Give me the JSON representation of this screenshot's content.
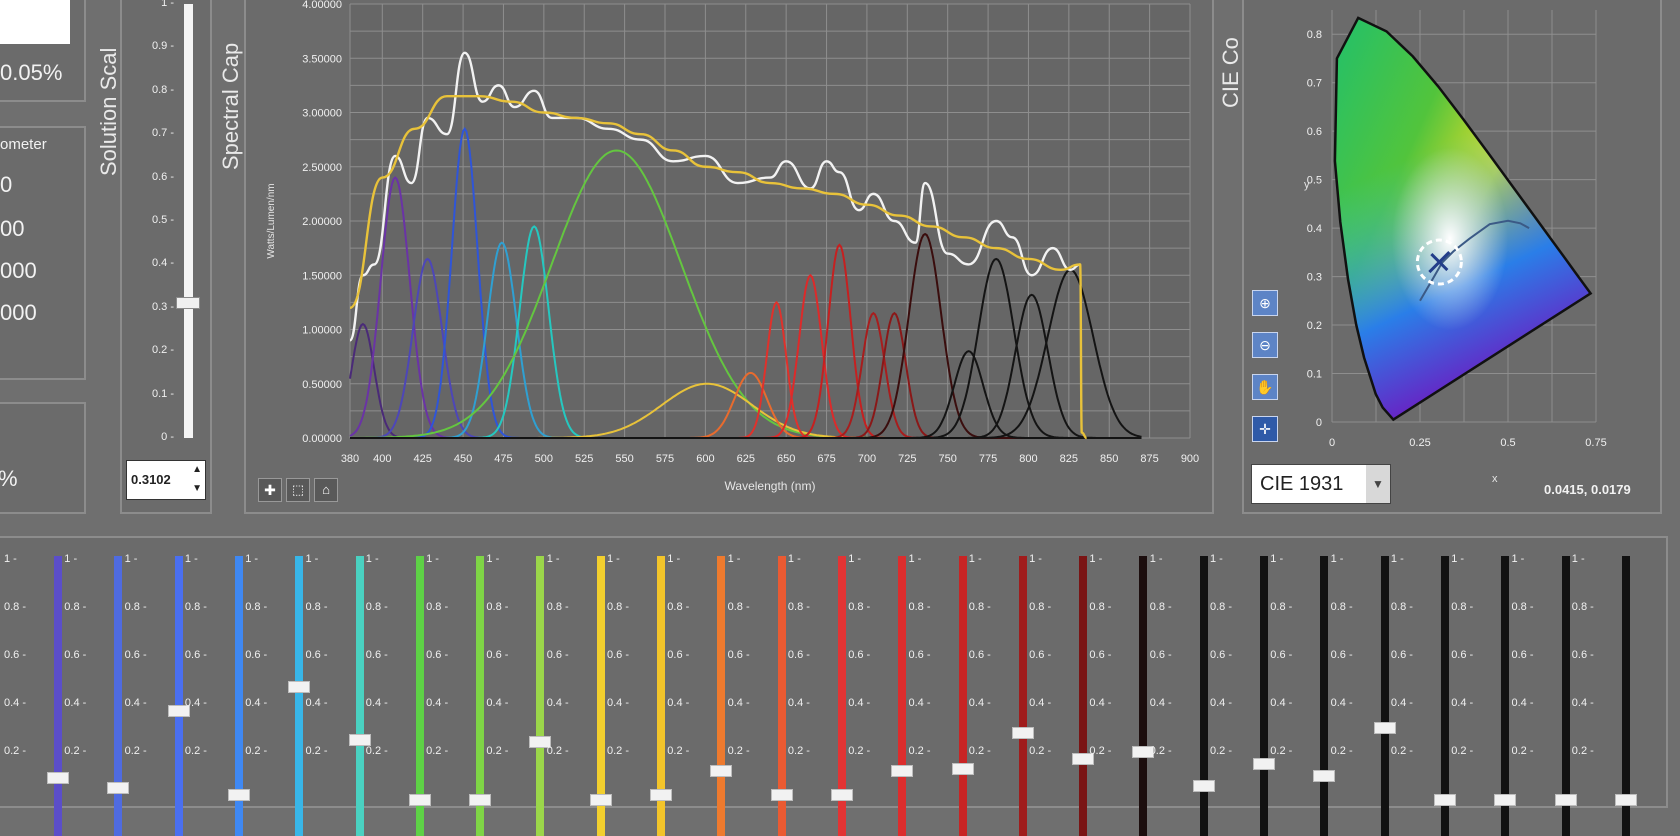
{
  "left_partial": {
    "box1_value": "0.05%",
    "box2_title": "ometer",
    "box2_values": [
      "0",
      "00",
      "000",
      "000"
    ],
    "box3_value": "%"
  },
  "solution_scale": {
    "title": "Solution Scal",
    "ticks": [
      "1",
      "0.9",
      "0.8",
      "0.7",
      "0.6",
      "0.5",
      "0.4",
      "0.3",
      "0.2",
      "0.1",
      "0"
    ],
    "value": 0.31,
    "input_value": "0.3102"
  },
  "spectral": {
    "title": "Spectral Cap",
    "ylabel": "Watts/Lumen/nm",
    "xlabel": "Wavelength (nm)",
    "y_ticks": [
      "0.00000",
      "0.50000",
      "1.00000",
      "1.50000",
      "2.00000",
      "2.50000",
      "3.00000",
      "3.50000",
      "4.00000"
    ],
    "x_ticks": [
      "380",
      "400",
      "425",
      "450",
      "475",
      "500",
      "525",
      "550",
      "575",
      "600",
      "625",
      "650",
      "675",
      "700",
      "725",
      "750",
      "775",
      "800",
      "825",
      "850",
      "875",
      "900"
    ]
  },
  "chart_data": {
    "type": "line",
    "xlabel": "Wavelength (nm)",
    "ylabel": "Watts/Lumen/nm",
    "xlim": [
      380,
      900
    ],
    "ylim": [
      0,
      4
    ],
    "grid": true,
    "series": [
      {
        "color": "#4a2a78",
        "peak_x": 388,
        "peak_y": 1.05,
        "width": 7
      },
      {
        "color": "#6a33a6",
        "peak_x": 408,
        "peak_y": 2.4,
        "width": 9
      },
      {
        "color": "#4d46b8",
        "peak_x": 428,
        "peak_y": 1.65,
        "width": 9
      },
      {
        "color": "#2f55d8",
        "peak_x": 451,
        "peak_y": 2.85,
        "width": 8
      },
      {
        "color": "#2fa0d2",
        "peak_x": 474,
        "peak_y": 1.8,
        "width": 9
      },
      {
        "color": "#25c8c0",
        "peak_x": 494,
        "peak_y": 1.95,
        "width": 9
      },
      {
        "color": "#64c640",
        "peak_x": 545,
        "peak_y": 2.65,
        "width": 40
      },
      {
        "color": "#e8c23a",
        "peak_x": 601,
        "peak_y": 0.5,
        "width": 28
      },
      {
        "color": "#e86b2e",
        "peak_x": 628,
        "peak_y": 0.6,
        "width": 10
      },
      {
        "color": "#e0312b",
        "peak_x": 644,
        "peak_y": 1.25,
        "width": 6
      },
      {
        "color": "#dd2a2a",
        "peak_x": 665,
        "peak_y": 1.5,
        "width": 7
      },
      {
        "color": "#c62020",
        "peak_x": 683,
        "peak_y": 1.78,
        "width": 7
      },
      {
        "color": "#a81d1d",
        "peak_x": 704,
        "peak_y": 1.15,
        "width": 7
      },
      {
        "color": "#8a1818",
        "peak_x": 717,
        "peak_y": 1.15,
        "width": 7
      },
      {
        "color": "#3a0d0d",
        "peak_x": 736,
        "peak_y": 1.88,
        "width": 10
      },
      {
        "color": "#141414",
        "peak_x": 763,
        "peak_y": 0.8,
        "width": 9
      },
      {
        "color": "#141414",
        "peak_x": 780,
        "peak_y": 1.65,
        "width": 11
      },
      {
        "color": "#141414",
        "peak_x": 802,
        "peak_y": 1.32,
        "width": 10
      },
      {
        "color": "#141414",
        "peak_x": 826,
        "peak_y": 1.55,
        "width": 14
      },
      {
        "color": "#f2f2f2",
        "name": "",
        "x": [
          380,
          388,
          395,
          408,
          418,
          428,
          440,
          451,
          462,
          472,
          482,
          494,
          505,
          520,
          540,
          560,
          580,
          600,
          620,
          640,
          650,
          665,
          675,
          683,
          695,
          704,
          717,
          730,
          736,
          750,
          763,
          780,
          790,
          802,
          815,
          826,
          832
        ],
        "y": [
          0.9,
          1.5,
          1.6,
          2.6,
          2.35,
          2.95,
          2.8,
          3.55,
          3.1,
          3.25,
          3.05,
          3.2,
          2.95,
          2.95,
          2.85,
          2.75,
          2.55,
          2.6,
          2.35,
          2.4,
          2.55,
          2.3,
          2.55,
          2.45,
          2.1,
          2.25,
          2.0,
          1.8,
          2.35,
          1.7,
          1.6,
          2.0,
          1.85,
          1.5,
          1.75,
          1.55,
          1.6
        ]
      },
      {
        "color": "#e8c23a",
        "name": "",
        "x": [
          380,
          400,
          420,
          440,
          460,
          480,
          500,
          520,
          540,
          560,
          580,
          600,
          620,
          640,
          660,
          680,
          700,
          720,
          740,
          760,
          780,
          800,
          820,
          832,
          833,
          836
        ],
        "y": [
          1.2,
          2.4,
          2.85,
          3.15,
          3.15,
          3.1,
          3.0,
          2.95,
          2.9,
          2.8,
          2.65,
          2.5,
          2.45,
          2.35,
          2.3,
          2.25,
          2.15,
          2.05,
          1.95,
          1.85,
          1.75,
          1.65,
          1.55,
          1.6,
          0.05,
          0
        ]
      }
    ]
  },
  "chart_tools": [
    "zoom-tool-icon",
    "pan-tool-icon",
    "home-tool-icon"
  ],
  "cie": {
    "title": "CIE Co",
    "y_ticks": [
      "0",
      "0.1",
      "0.2",
      "0.3",
      "0.4",
      "0.5",
      "0.6",
      "0.7",
      "0.8"
    ],
    "x_ticks": [
      "0",
      "0.25",
      "0.5",
      "0.75"
    ],
    "xlabel": "x",
    "ylabel": "y",
    "select_value": "CIE 1931",
    "coord_readout": "0.0415, 0.0179",
    "tools": [
      "zoom-in-icon",
      "zoom-out-icon",
      "pan-icon",
      "crosshair-icon"
    ]
  },
  "channels": {
    "tick_labels": [
      "1",
      "0.8",
      "0.6",
      "0.4",
      "0.2"
    ],
    "items": [
      {
        "color": "#5b4ec9",
        "level": 0.09
      },
      {
        "color": "#4f6be0",
        "level": 0.05
      },
      {
        "color": "#4a6ff0",
        "level": 0.37
      },
      {
        "color": "#3f88f2",
        "level": 0.02
      },
      {
        "color": "#38b6e8",
        "level": 0.47
      },
      {
        "color": "#4ad1c1",
        "level": 0.25
      },
      {
        "color": "#5ed146",
        "level": 0.0
      },
      {
        "color": "#7fd446",
        "level": 0.0
      },
      {
        "color": "#9bd64a",
        "level": 0.24
      },
      {
        "color": "#f2cf2e",
        "level": 0.0
      },
      {
        "color": "#f2c42a",
        "level": 0.02
      },
      {
        "color": "#ee7a2e",
        "level": 0.12
      },
      {
        "color": "#ea5a32",
        "level": 0.02
      },
      {
        "color": "#e23434",
        "level": 0.02
      },
      {
        "color": "#dc2d2d",
        "level": 0.12
      },
      {
        "color": "#c82424",
        "level": 0.13
      },
      {
        "color": "#a01c1c",
        "level": 0.28
      },
      {
        "color": "#7a1414",
        "level": 0.17
      },
      {
        "color": "#1c0e0e",
        "level": 0.2
      },
      {
        "color": "#121212",
        "level": 0.06
      },
      {
        "color": "#121212",
        "level": 0.15
      },
      {
        "color": "#121212",
        "level": 0.1
      },
      {
        "color": "#121212",
        "level": 0.3
      },
      {
        "color": "#121212",
        "level": 0.0
      },
      {
        "color": "#121212",
        "level": 0.0
      },
      {
        "color": "#121212",
        "level": 0.0
      },
      {
        "color": "#121212",
        "level": 0.0
      }
    ]
  }
}
